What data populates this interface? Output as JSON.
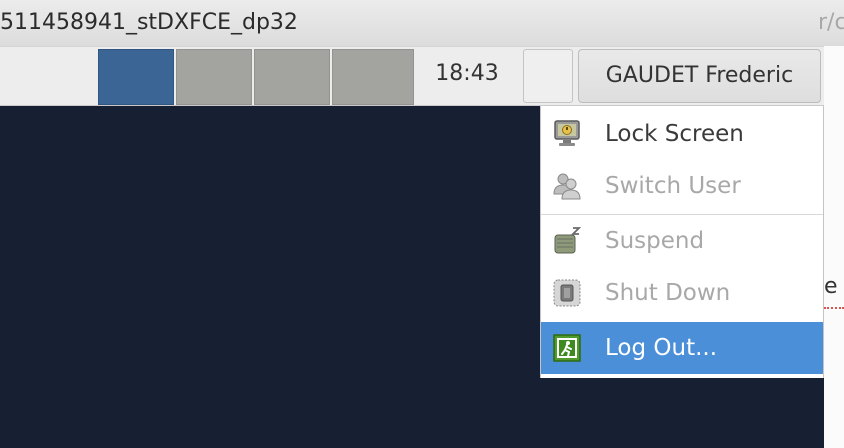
{
  "window": {
    "title": "511458941_stDXFCE_dp32",
    "title_right_fragment": "r/c"
  },
  "panel": {
    "workspaces": [
      {
        "state": "active",
        "color": "#3a6594"
      },
      {
        "state": "inactive",
        "color": "#a3a4a0"
      },
      {
        "state": "inactive",
        "color": "#a3a4a0"
      },
      {
        "state": "inactive",
        "color": "#a3a4a0"
      }
    ],
    "clock": "18:43",
    "user_button": "GAUDET Frederic"
  },
  "desktop": {
    "background": "#172033",
    "peek_text": "e"
  },
  "menu": {
    "items": [
      {
        "label": "Lock Screen",
        "icon": "lock-screen-icon",
        "enabled": true
      },
      {
        "label": "Switch User",
        "icon": "switch-user-icon",
        "enabled": false
      },
      {
        "label": "Suspend",
        "icon": "suspend-icon",
        "enabled": false
      },
      {
        "label": "Shut Down",
        "icon": "shutdown-icon",
        "enabled": false
      },
      {
        "label": "Log Out...",
        "icon": "logout-icon",
        "enabled": true,
        "highlighted": true
      }
    ],
    "highlight_color": "#4a8fd8"
  }
}
